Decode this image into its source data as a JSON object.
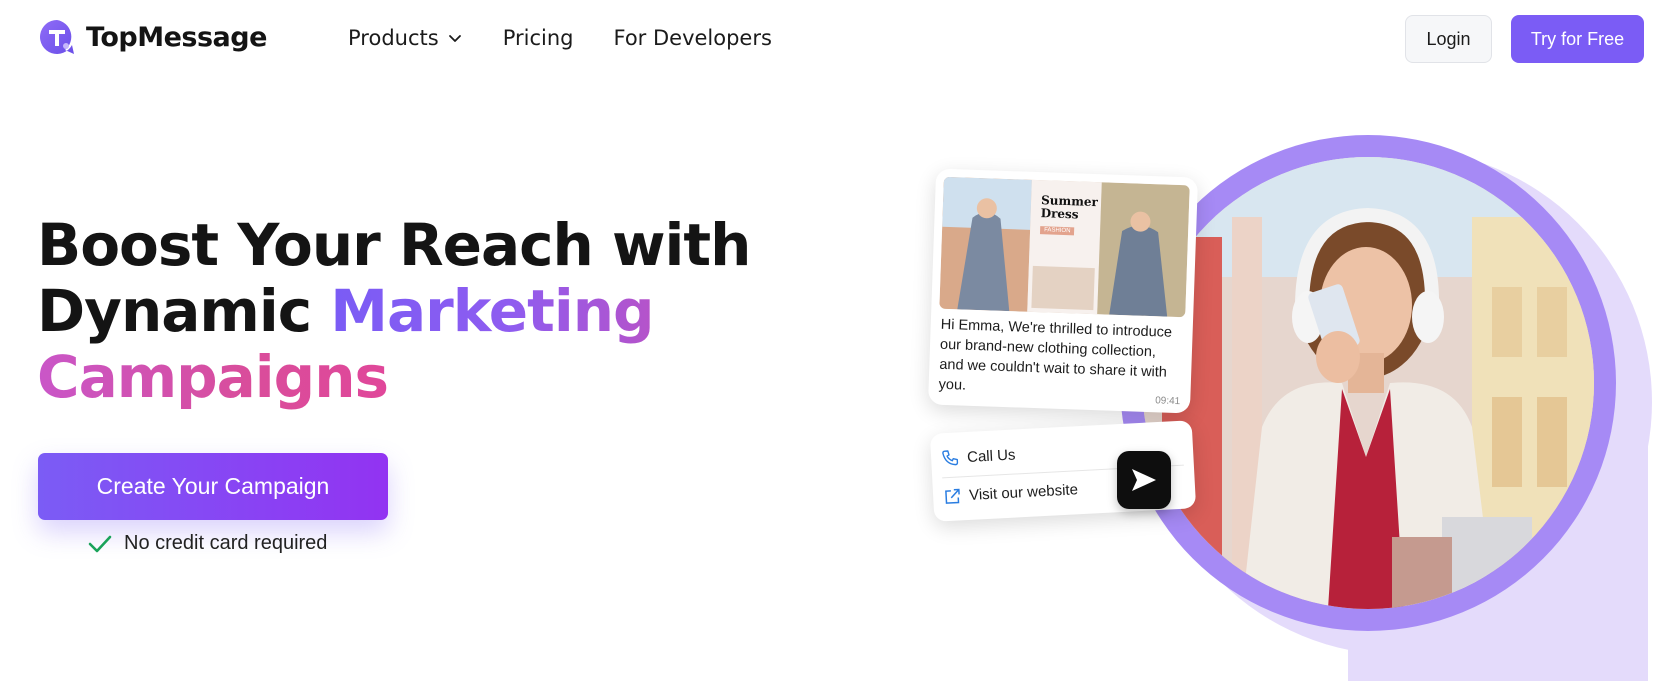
{
  "brand": {
    "name": "TopMessage",
    "accent": "#7b5cf5"
  },
  "nav": {
    "links": [
      {
        "label": "Products",
        "has_dropdown": true
      },
      {
        "label": "Pricing"
      },
      {
        "label": "For Developers"
      }
    ],
    "login_label": "Login",
    "try_label": "Try for Free"
  },
  "hero": {
    "title_line1": "Boost Your Reach with",
    "title_line2_prefix": "Dynamic ",
    "title_line2_highlight": "Marketing",
    "title_line3_highlight": "Campaigns",
    "cta_label": "Create Your Campaign",
    "note": "No credit card required",
    "note_icon": "check-icon",
    "note_icon_color": "#1aa35a"
  },
  "illustration": {
    "promo_title": "Summer Dress",
    "promo_tag": "FASHION",
    "message_text": "Hi Emma, We're thrilled to introduce our brand-new clothing collection, and we couldn't wait to share it with you.",
    "message_time": "09:41",
    "actions": [
      {
        "label": "Call Us",
        "icon": "phone-icon"
      },
      {
        "label": "Visit our website",
        "icon": "external-link-icon"
      }
    ],
    "send_icon": "send-icon",
    "ring_color": "#a68af5"
  }
}
